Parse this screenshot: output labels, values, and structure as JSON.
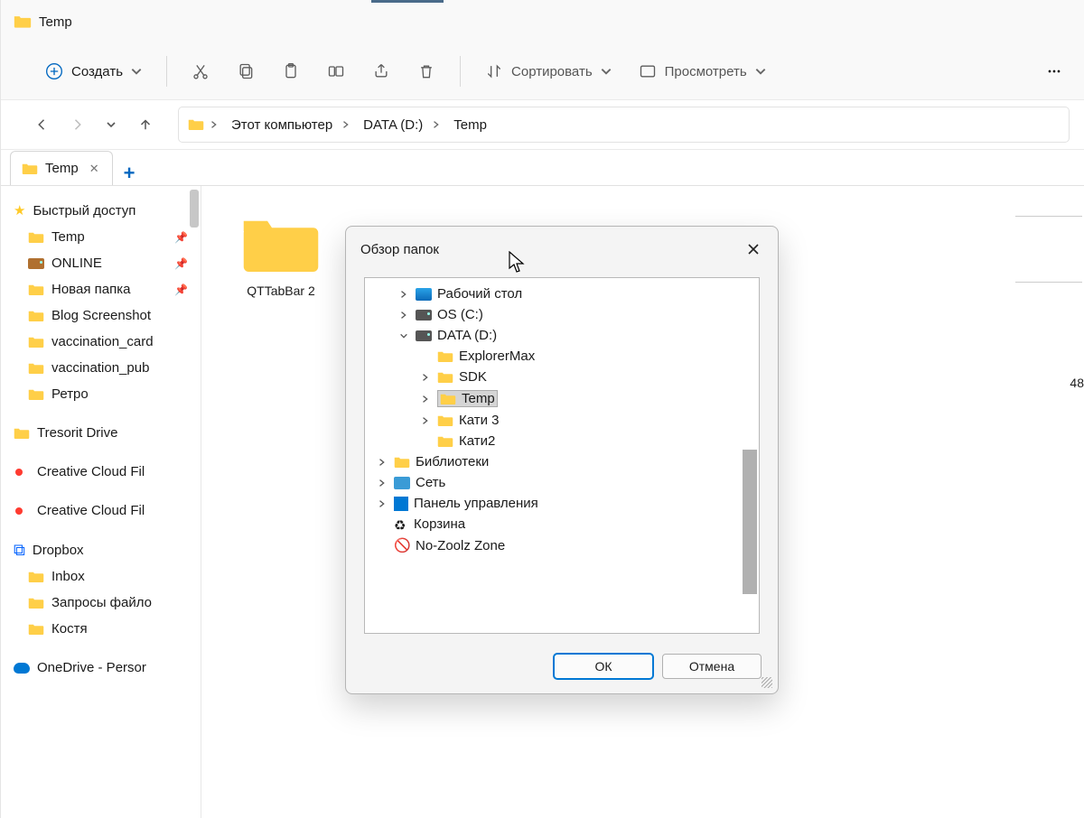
{
  "titlebar": {
    "title": "Temp"
  },
  "toolbar": {
    "create_label": "Создать",
    "sort_label": "Сортировать",
    "view_label": "Просмотреть"
  },
  "breadcrumb": {
    "items": [
      "Этот компьютер",
      "DATA (D:)",
      "Temp"
    ]
  },
  "tab": {
    "label": "Temp"
  },
  "sidebar": {
    "quick_access": "Быстрый доступ",
    "items": [
      {
        "label": "Temp",
        "pinned": true
      },
      {
        "label": "ONLINE",
        "pinned": true,
        "special": "drive"
      },
      {
        "label": "Новая папка",
        "pinned": true
      },
      {
        "label": "Blog Screenshot"
      },
      {
        "label": "vaccination_card"
      },
      {
        "label": "vaccination_pub"
      },
      {
        "label": "Ретро"
      }
    ],
    "tresorit": "Tresorit Drive",
    "cc1": "Creative Cloud Fil",
    "cc2": "Creative Cloud Fil",
    "dropbox": "Dropbox",
    "dropbox_items": [
      {
        "label": "Inbox"
      },
      {
        "label": "Запросы файло"
      },
      {
        "label": "Костя"
      }
    ],
    "onedrive": "OneDrive - Persor"
  },
  "files": {
    "f0_label": "QTTabBar 2",
    "f1_suffix": "48"
  },
  "dialog": {
    "title": "Обзор папок",
    "ok_label": "ОК",
    "cancel_label": "Отмена",
    "tree": {
      "desktop": "Рабочий стол",
      "osc": "OS (C:)",
      "datad": "DATA (D:)",
      "explorermax": "ExplorerMax",
      "sdk": "SDK",
      "temp": "Temp",
      "kati3": "Кати 3",
      "kati2": "Кати2",
      "libraries": "Библиотеки",
      "network": "Сеть",
      "control": "Панель управления",
      "recycle": "Корзина",
      "nozoolz": "No-Zoolz Zone"
    }
  }
}
